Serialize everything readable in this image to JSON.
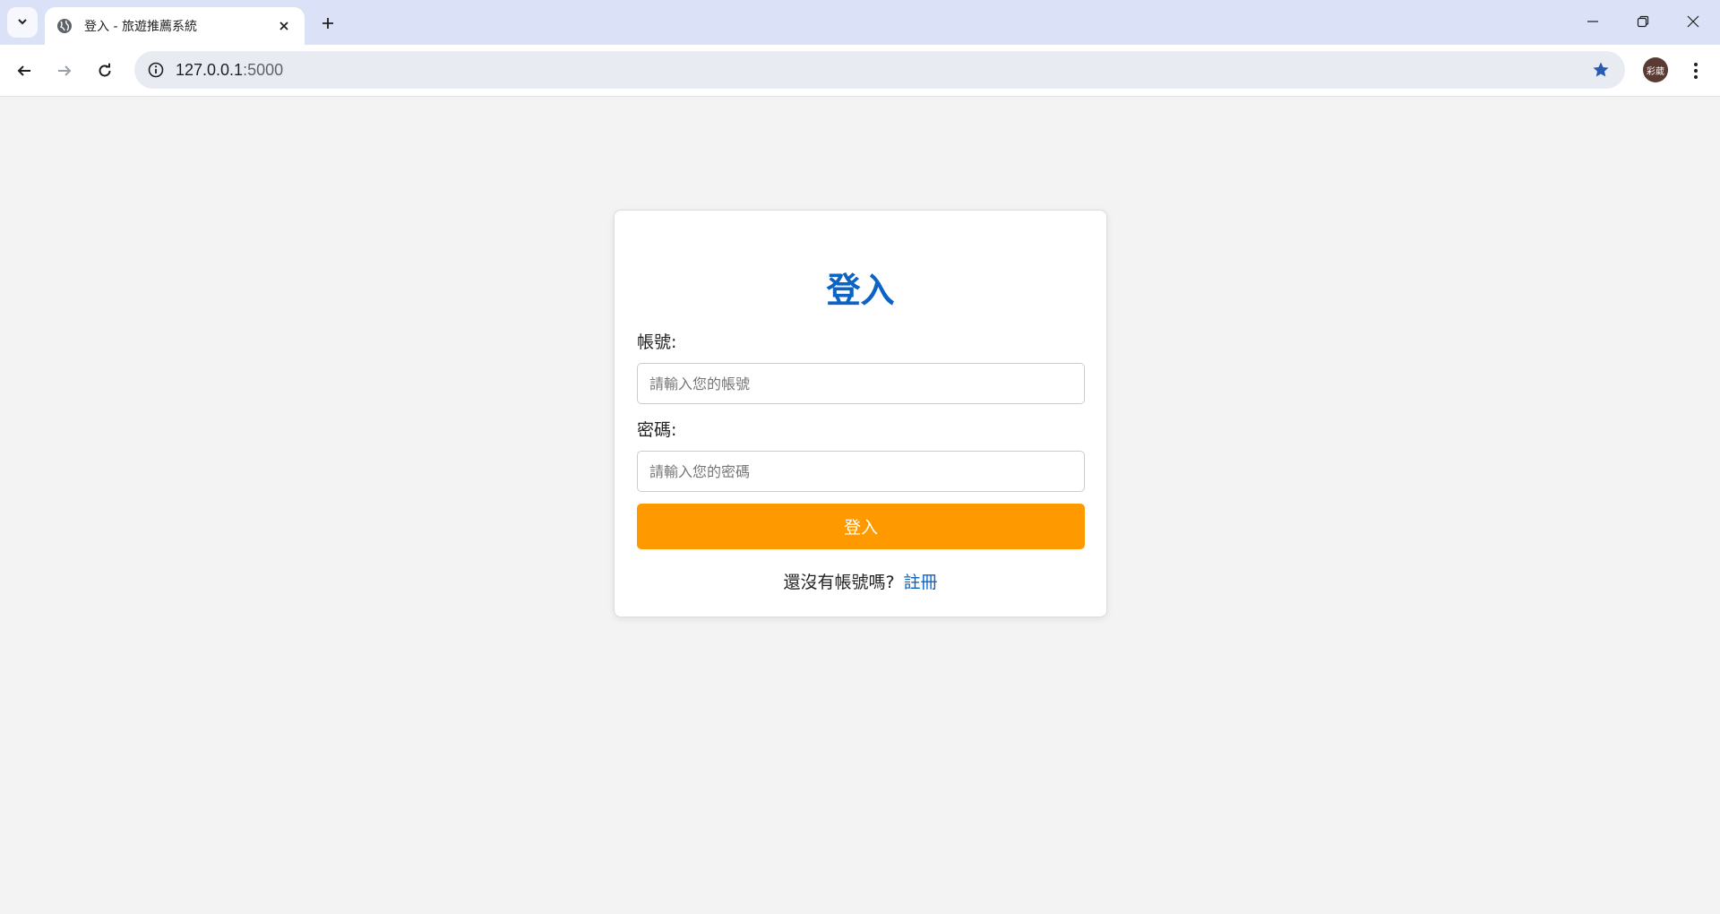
{
  "browser": {
    "tab_title": "登入 - 旅遊推薦系統",
    "url_host": "127.0.0.1",
    "url_port": ":5000",
    "profile_initials": "彩葳",
    "icons": {
      "tab_search": "chevron-down-icon",
      "favicon": "globe-icon",
      "tab_close": "close-icon",
      "new_tab": "plus-icon",
      "back": "arrow-left-icon",
      "forward": "arrow-right-icon",
      "reload": "reload-icon",
      "site_info": "info-icon",
      "bookmark": "star-icon",
      "menu": "kebab-menu-icon",
      "minimize": "minimize-icon",
      "restore": "restore-icon",
      "close_window": "close-icon"
    }
  },
  "login": {
    "title": "登入",
    "username_label": "帳號:",
    "username_placeholder": "請輸入您的帳號",
    "username_value": "",
    "password_label": "密碼:",
    "password_placeholder": "請輸入您的密碼",
    "password_value": "",
    "submit_label": "登入",
    "register_prompt": "還沒有帳號嗎?",
    "register_link": "註冊"
  },
  "colors": {
    "accent": "#0b63c4",
    "button": "#ff9900",
    "page_bg": "#f3f3f3",
    "tabstrip_bg": "#dbe2f7"
  }
}
